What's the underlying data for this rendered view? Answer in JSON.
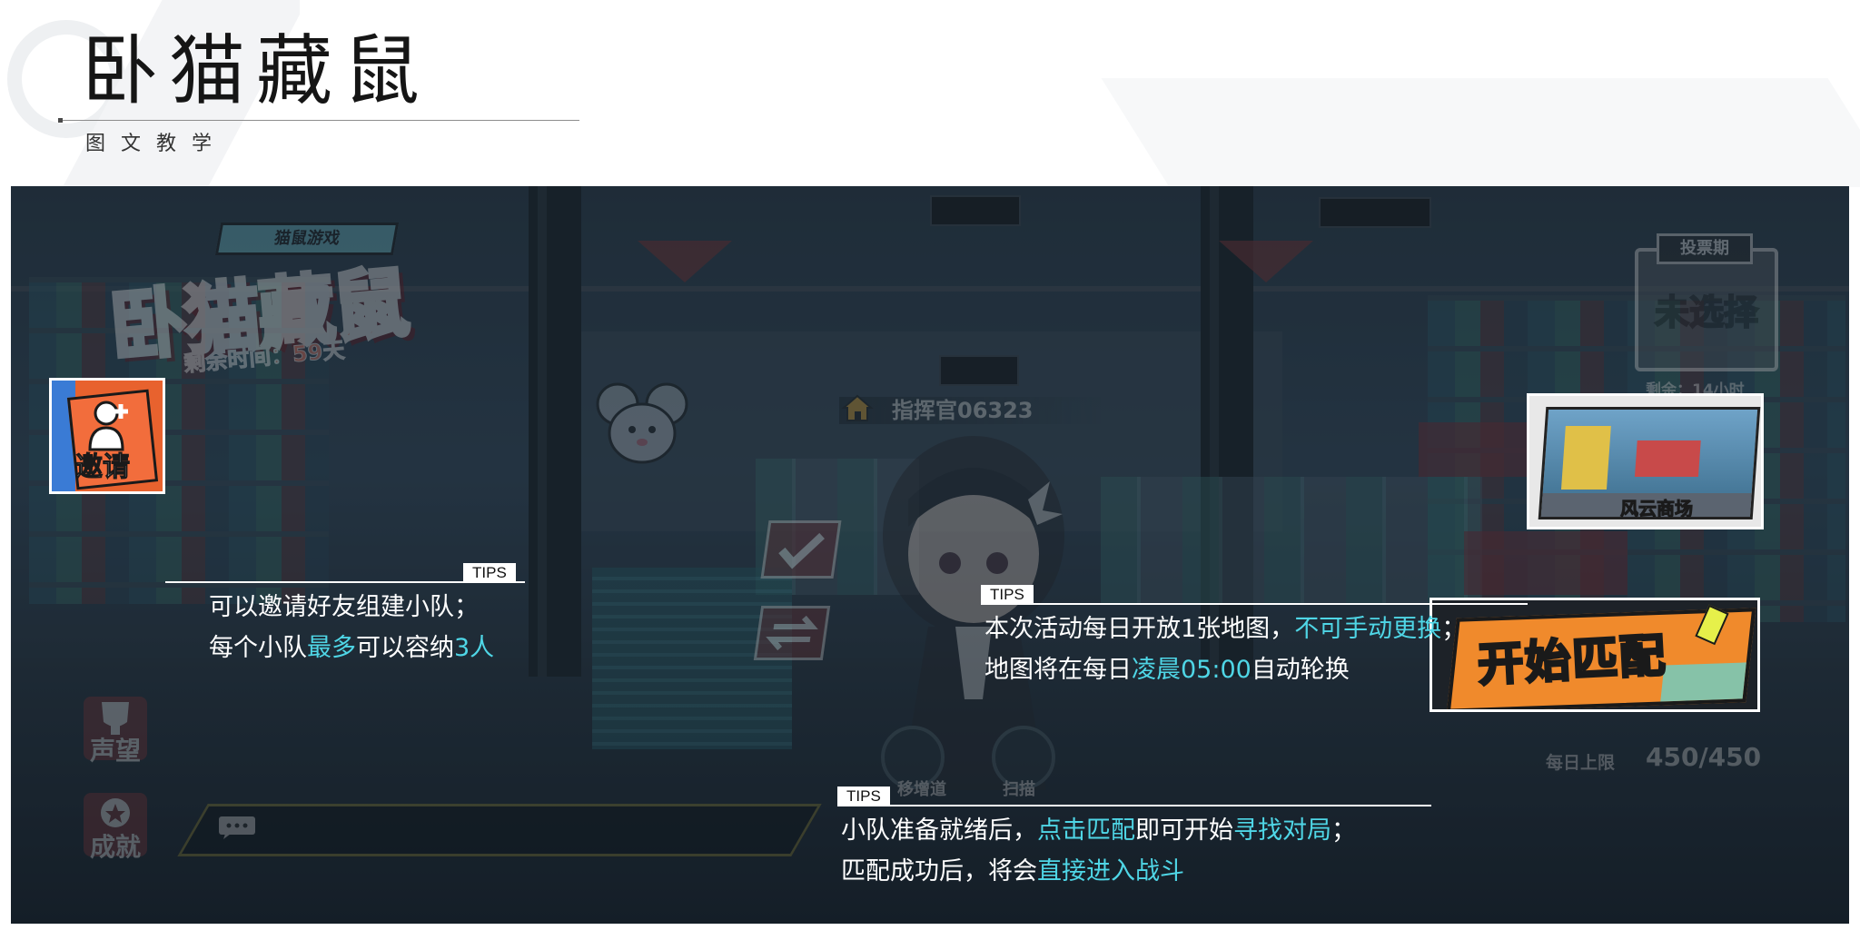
{
  "header": {
    "title": "卧猫藏鼠",
    "subtitle": "图文教学"
  },
  "game": {
    "logo_tag": "猫鼠游戏",
    "logo_title": "卧猫藏鼠",
    "remaining_time": "剩余时间：59天",
    "vote_tab": "投票期",
    "vote_status": "未选择",
    "vote_remaining": "剩余：14小时",
    "commander_name": "指挥官06323",
    "side_buttons": {
      "reputation": "声望",
      "achievement": "成就"
    },
    "mini_buttons": {
      "left": "移增道",
      "right": "扫描"
    },
    "daily_limit_label": "每日上限",
    "daily_limit_value": "450/450",
    "invite_label": "邀请",
    "market_label": "风云商场",
    "match_label": "开始匹配"
  },
  "tips": {
    "badge": "TIPS",
    "invite": {
      "line1": "可以邀请好友组建小队；",
      "line2_a": "每个小队",
      "line2_hi1": "最多",
      "line2_b": "可以容纳",
      "line2_hi2": "3人"
    },
    "map": {
      "line1_a": "本次活动每日开放1张地图，",
      "line1_hi": "不可手动更换",
      "line1_b": "；",
      "line2_a": "地图将在每日",
      "line2_hi": "凌晨05:00",
      "line2_b": "自动轮换"
    },
    "match": {
      "line1_a": "小队准备就绪后，",
      "line1_hi1": "点击匹配",
      "line1_b": "即可开始",
      "line1_hi2": "寻找对局",
      "line1_c": "；",
      "line2_a": "匹配成功后，将会",
      "line2_hi": "直接进入战斗"
    }
  },
  "colors": {
    "highlight": "#4fd6e6",
    "overlay": "#24323f",
    "accent_orange": "#f08a2c"
  }
}
